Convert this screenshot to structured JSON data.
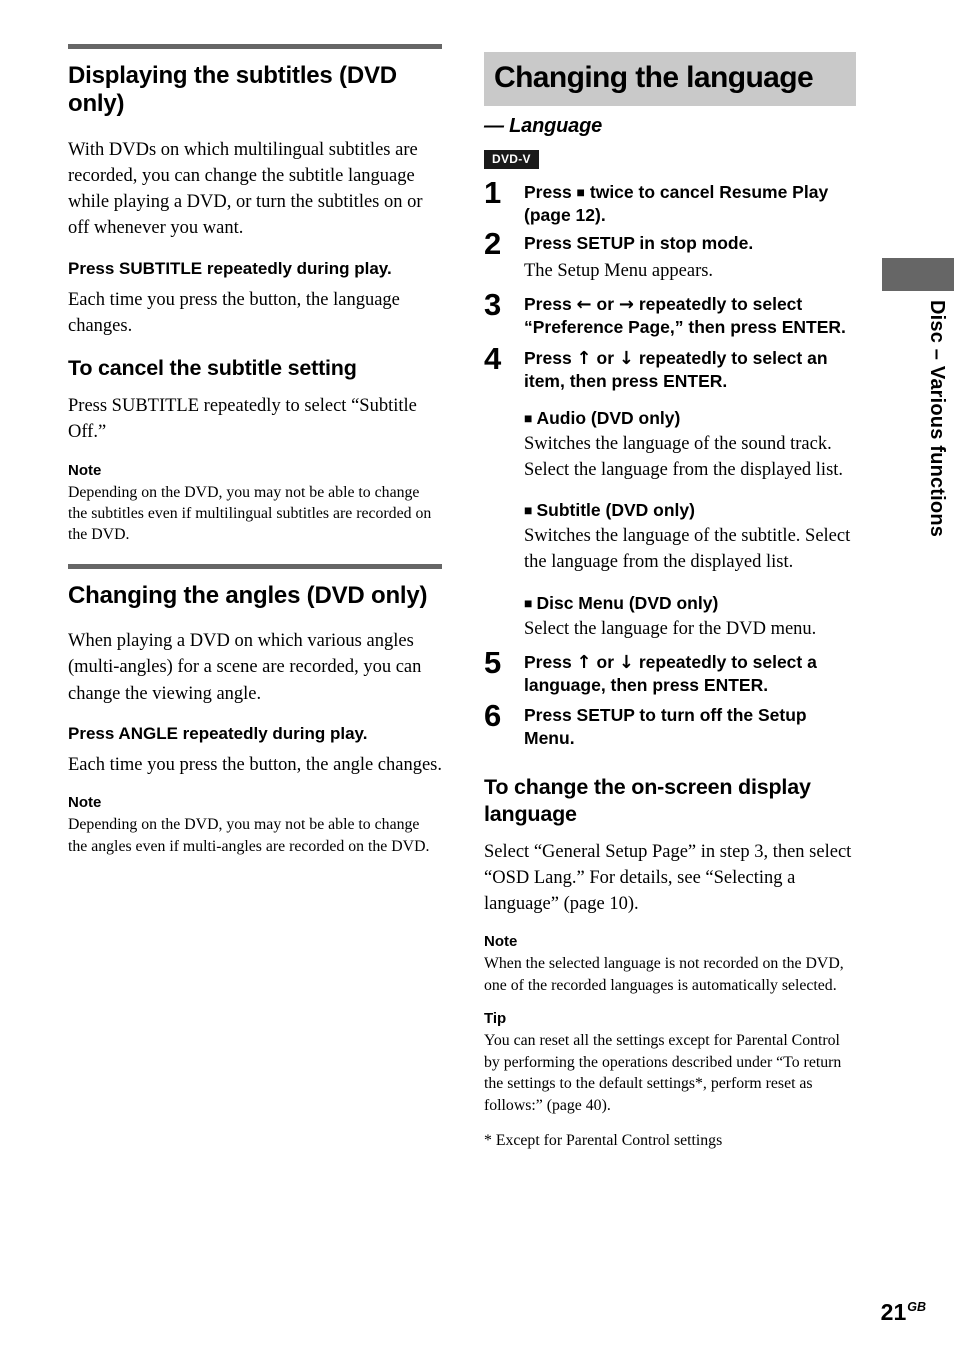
{
  "page": {
    "number": "21",
    "number_suffix": "GB"
  },
  "side_tab": {
    "label": "Disc – Various functions"
  },
  "left_column": {
    "sections": [
      {
        "title": "Displaying the subtitles (DVD only)",
        "intro": "With DVDs on which multilingual subtitles are recorded, you can change the subtitle language while playing a DVD, or turn the subtitles on or off whenever you want.",
        "action_head": "Press SUBTITLE repeatedly during play.",
        "action_body": "Each time you press the button, the language changes.",
        "sub_head": "To cancel the subtitle setting",
        "sub_body": "Press SUBTITLE repeatedly to select “Subtitle Off.”",
        "note_label": "Note",
        "note_body": "Depending on the DVD, you may not be able to change the subtitles even if multilingual subtitles are recorded on the DVD."
      },
      {
        "title": "Changing the angles (DVD only)",
        "intro": "When playing a DVD on which various angles (multi-angles) for a scene are recorded, you can change the viewing angle.",
        "action_head": "Press ANGLE repeatedly during play.",
        "action_body": "Each time you press the button, the angle changes.",
        "note_label": "Note",
        "note_body": "Depending on the DVD, you may not be able to change the angles even if multi-angles are recorded on the DVD."
      }
    ]
  },
  "right_column": {
    "band_title": "Changing the language",
    "subtitle": "— Language",
    "badge": "DVD-V",
    "steps": [
      {
        "number": "1",
        "text_before": "Press ",
        "glyph": "■",
        "text_after": " twice to cancel Resume Play (page 12).",
        "sub": ""
      },
      {
        "number": "2",
        "text_before": "Press SETUP in stop mode.",
        "glyph": "",
        "text_after": "",
        "sub": "The Setup Menu appears."
      },
      {
        "number": "3",
        "text_before": "Press ",
        "glyph": "←",
        "text_mid": " or ",
        "glyph2": "→",
        "text_after": " repeatedly to select “Preference Page,” then press ENTER.",
        "sub": ""
      },
      {
        "number": "4",
        "text_before": "Press ",
        "glyph": "↑",
        "text_mid": " or ",
        "glyph2": "↓",
        "text_after": " repeatedly to select an item, then press ENTER.",
        "sub": ""
      },
      {
        "number": "5",
        "text_before": "Press ",
        "glyph": "↑",
        "text_mid": " or ",
        "glyph2": "↓",
        "text_after": " repeatedly to select a language, then press ENTER.",
        "sub": ""
      },
      {
        "number": "6",
        "text_before": "Press SETUP to turn off the Setup Menu.",
        "glyph": "",
        "text_after": "",
        "sub": ""
      }
    ],
    "bullets": [
      {
        "head": "Audio (DVD only)",
        "body": "Switches the language of the sound track. Select the language from the displayed list."
      },
      {
        "head": "Subtitle (DVD only)",
        "body": "Switches the language of the subtitle. Select the language from the displayed list."
      },
      {
        "head": "Disc Menu (DVD only)",
        "body": "Select the language for the DVD menu."
      }
    ],
    "osd_section": {
      "head": "To change the on-screen display language",
      "body": "Select “General Setup Page” in step 3, then select “OSD Lang.” For details, see “Selecting a language” (page 10)."
    },
    "note": {
      "label": "Note",
      "body": "When the selected language is not recorded on the DVD, one of the recorded languages is automatically selected."
    },
    "tip": {
      "label": "Tip",
      "body": "You can reset all the settings except for Parental Control by performing the operations described under “To return the settings to the default settings*, perform reset as follows:” (page 40).",
      "footnote": "* Except for Parental Control settings"
    }
  },
  "colors": {
    "rule": "#666666",
    "band_bg": "#c9c9c9",
    "badge_bg": "#1a1a1a",
    "tab": "#666666"
  }
}
